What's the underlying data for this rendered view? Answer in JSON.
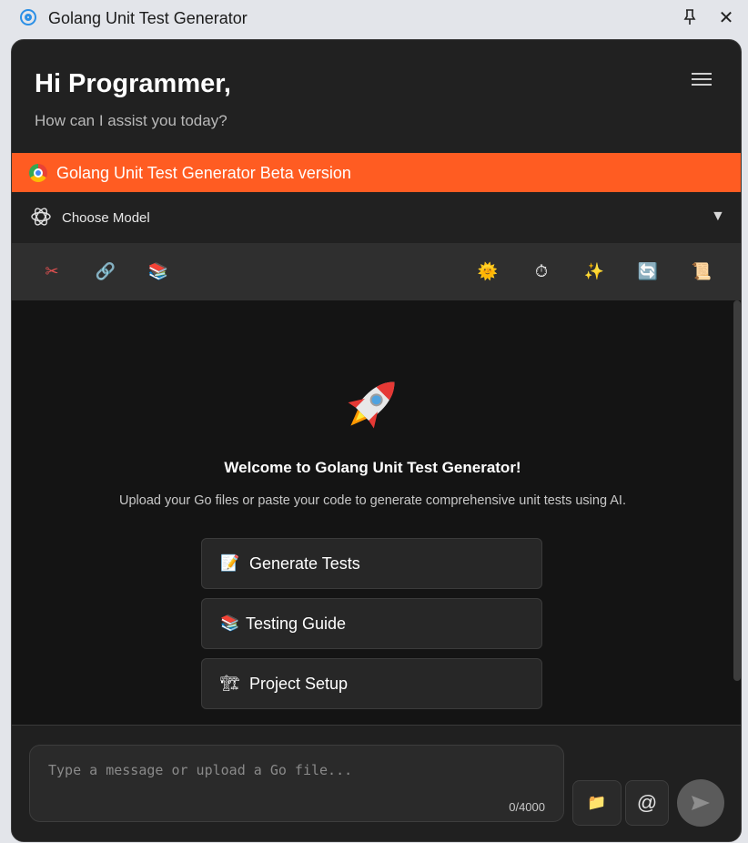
{
  "window": {
    "title": "Golang Unit Test Generator",
    "pin_glyph": "🖈",
    "close_glyph": "✕"
  },
  "header": {
    "greeting": "Hi Programmer,",
    "subtitle": "How can I assist you today?"
  },
  "banner": {
    "text": "Golang Unit Test Generator Beta version",
    "color": "#ff5c22"
  },
  "model": {
    "label": "Choose Model",
    "caret": "▼"
  },
  "toolbar": {
    "left_tools": [
      {
        "name": "scissors-icon",
        "glyph": "✂"
      },
      {
        "name": "link-icon",
        "glyph": "🔗"
      },
      {
        "name": "books-icon",
        "glyph": "📚"
      }
    ],
    "right_tools": [
      {
        "name": "sun-icon",
        "glyph": "🌞"
      },
      {
        "name": "stopwatch-icon",
        "glyph": "⏱"
      },
      {
        "name": "sparkles-icon",
        "glyph": "✨"
      },
      {
        "name": "refresh-icon",
        "glyph": "🔄"
      },
      {
        "name": "scroll-icon",
        "glyph": "📜"
      }
    ]
  },
  "welcome": {
    "title": "Welcome to Golang Unit Test Generator!",
    "subtitle": "Upload your Go files or paste your code to generate comprehensive unit tests using AI."
  },
  "actions": [
    {
      "icon": "📝",
      "label": "Generate Tests"
    },
    {
      "icon": "📚",
      "label": "Testing Guide"
    },
    {
      "icon": "🏗",
      "label": "Project Setup"
    }
  ],
  "composer": {
    "placeholder": "Type a message or upload a Go file...",
    "counter": "0/4000",
    "folder_glyph": "📁",
    "mention_glyph": "@"
  }
}
